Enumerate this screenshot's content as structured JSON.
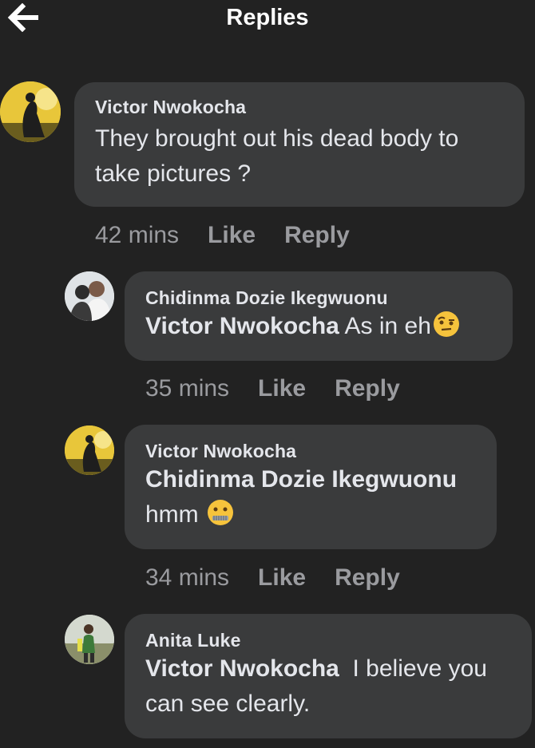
{
  "header": {
    "title": "Replies",
    "back_icon": "arrow-left-icon"
  },
  "comments": [
    {
      "author": "Victor Nwokocha",
      "text_lines": [
        "They brought out his dead body to",
        "take pictures ?"
      ],
      "time": "42 mins",
      "like": "Like",
      "reply": "Reply"
    },
    {
      "author": "Chidinma Dozie Ikegwuonu",
      "mention": "Victor Nwokocha",
      "text": "As in eh",
      "emoji": "raised-eyebrow-emoji",
      "time": "35 mins",
      "like": "Like",
      "reply": "Reply"
    },
    {
      "author": "Victor Nwokocha",
      "mention": "Chidinma Dozie Ikegwuonu",
      "text": "hmm",
      "emoji": "zipper-mouth-emoji",
      "time": "34 mins",
      "like": "Like",
      "reply": "Reply"
    },
    {
      "author": "Anita Luke",
      "mention": "Victor Nwokocha",
      "text_lines": [
        "I believe you",
        "can see clearly."
      ]
    }
  ],
  "colors": {
    "background": "#222222",
    "bubble": "#3a3b3c",
    "meta": "#9a9b9f"
  }
}
